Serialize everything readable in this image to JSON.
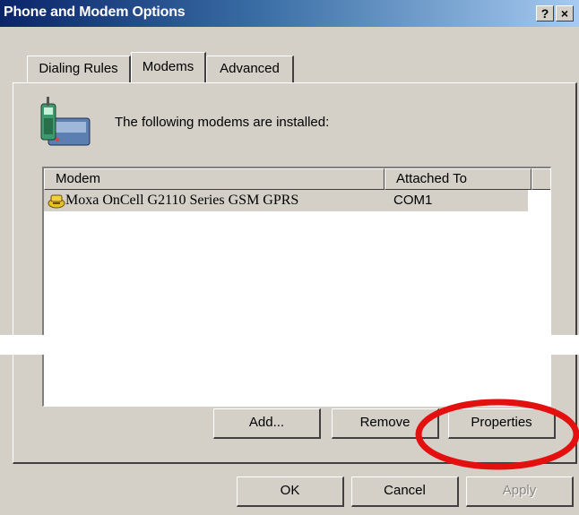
{
  "window": {
    "title": "Phone and Modem Options",
    "help_glyph": "?",
    "close_glyph": "×"
  },
  "tabs": [
    {
      "label": "Dialing Rules"
    },
    {
      "label": "Modems"
    },
    {
      "label": "Advanced"
    }
  ],
  "modems_tab": {
    "intro_text": "The following modems are installed:",
    "intro_icon": "phone-modem-icon",
    "columns": [
      "Modem",
      "Attached To"
    ],
    "rows": [
      {
        "modem": "Moxa OnCell G2110 Series GSM GPRS",
        "attached_to": "COM1",
        "icon": "modem-icon"
      }
    ],
    "buttons": {
      "add": "Add...",
      "remove": "Remove",
      "properties": "Properties"
    }
  },
  "dialog_buttons": {
    "ok": "OK",
    "cancel": "Cancel",
    "apply": "Apply"
  },
  "colors": {
    "annotation_circle": "#e41010",
    "selected_row": "#d4d0c8",
    "title_start": "#0a246a"
  }
}
